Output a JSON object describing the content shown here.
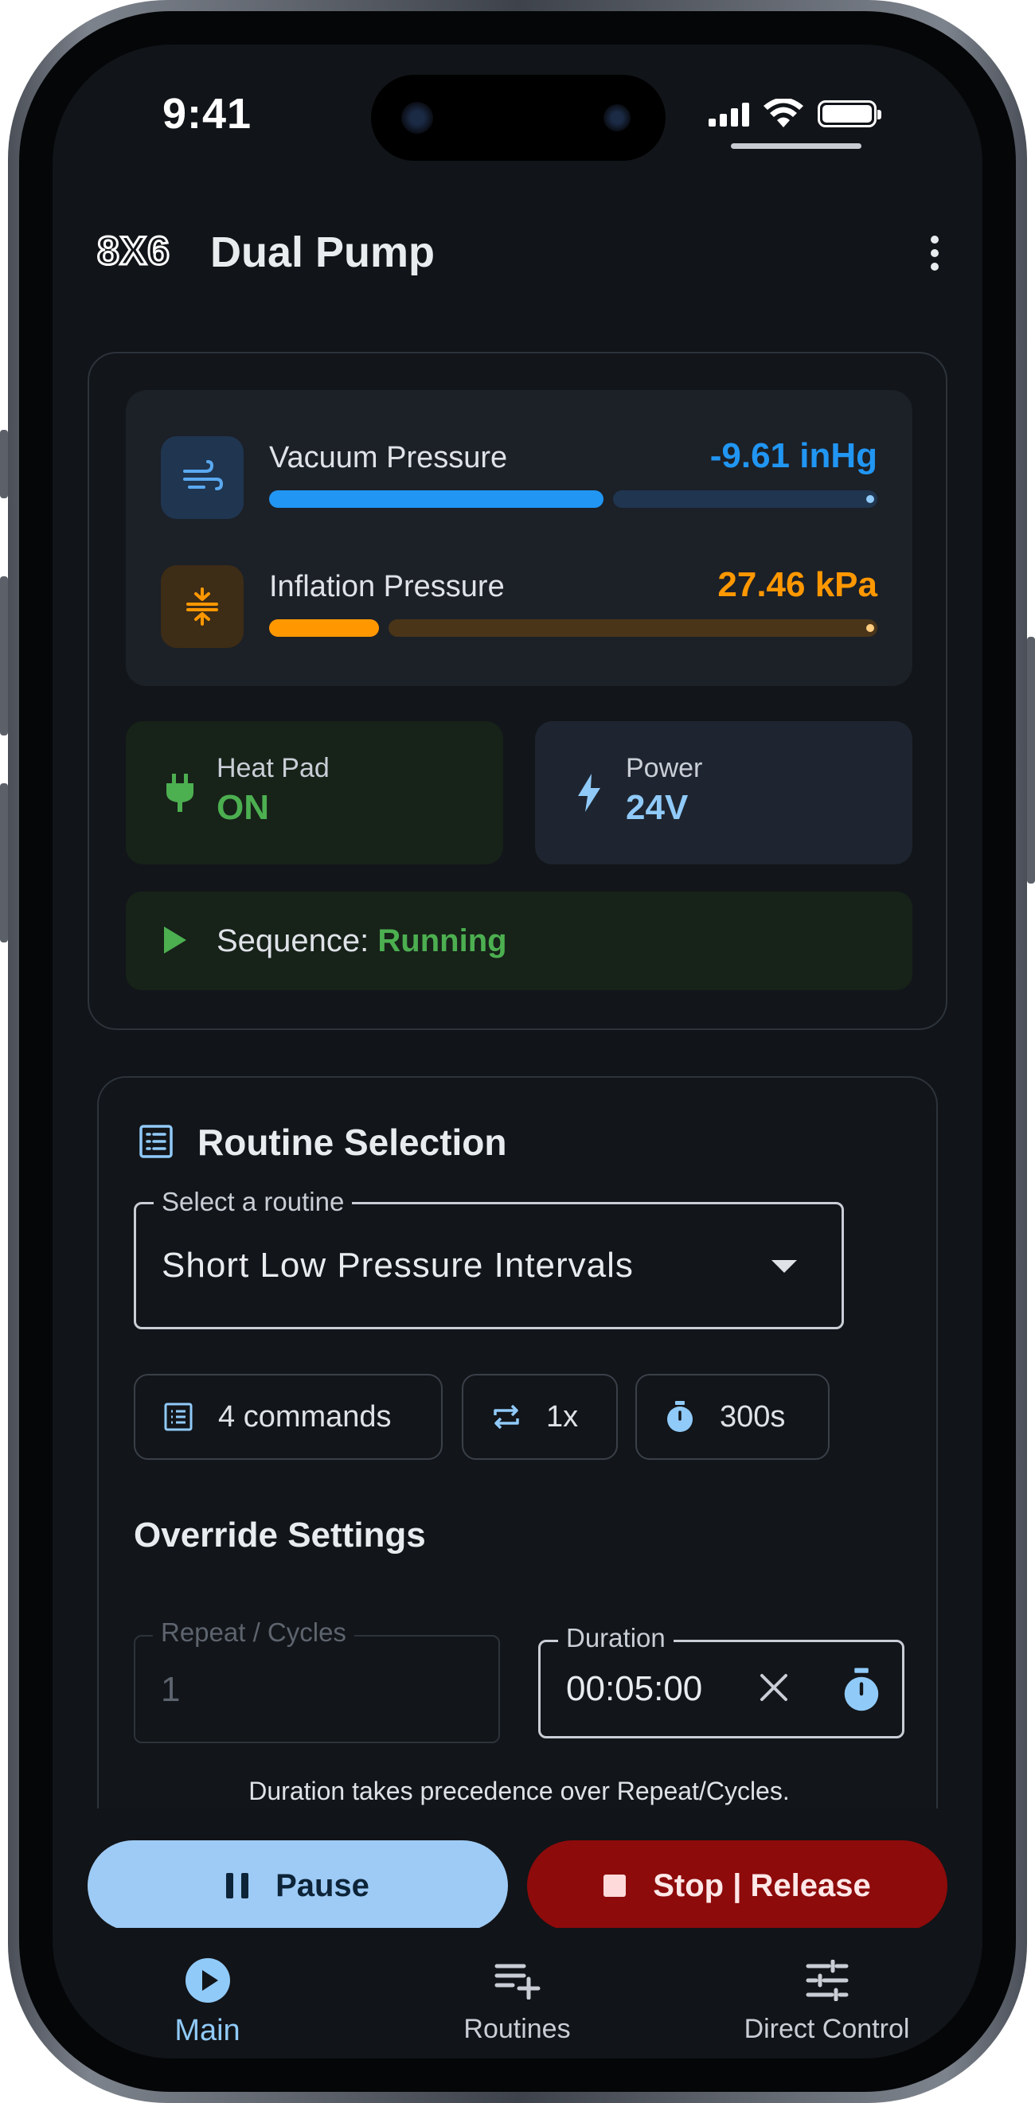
{
  "status_bar": {
    "time": "9:41"
  },
  "app_bar": {
    "logo_text": "8X6",
    "title": "Dual Pump"
  },
  "pressures": {
    "vacuum": {
      "label": "Vacuum Pressure",
      "value": "-9.61 inHg",
      "level": 0.55,
      "color": "#2196f3"
    },
    "inflation": {
      "label": "Inflation Pressure",
      "value": "27.46 kPa",
      "level": 0.18,
      "color": "#ff9800"
    }
  },
  "tiles": {
    "heat_pad": {
      "label": "Heat Pad",
      "value": "ON",
      "color": "#4caf50"
    },
    "power": {
      "label": "Power",
      "value": "24V",
      "color": "#90caf9"
    }
  },
  "sequence": {
    "label": "Sequence:",
    "state": "Running",
    "color": "#4caf50"
  },
  "routine": {
    "title": "Routine Selection",
    "select_label": "Select a routine",
    "select_value": "Short Low Pressure Intervals",
    "chips": [
      {
        "icon": "list-icon",
        "label": "4 commands"
      },
      {
        "icon": "repeat-icon",
        "label": "1x"
      },
      {
        "icon": "timer-icon",
        "label": "300s"
      }
    ],
    "override_title": "Override Settings",
    "repeat_field": {
      "label": "Repeat / Cycles",
      "value": "1"
    },
    "duration_field": {
      "label": "Duration",
      "value": "00:05:00"
    },
    "helper_text": "Duration takes precedence over Repeat/Cycles."
  },
  "actions": {
    "pause_label": "Pause",
    "stop_label": "Stop | Release"
  },
  "nav": {
    "items": [
      {
        "label": "Main",
        "icon": "play-circle-icon",
        "active": true
      },
      {
        "label": "Routines",
        "icon": "playlist-add-icon",
        "active": false
      },
      {
        "label": "Direct Control",
        "icon": "tune-icon",
        "active": false
      }
    ]
  },
  "colors": {
    "accent": "#90caf9",
    "background": "#111418",
    "stop": "#8d0b0b"
  }
}
